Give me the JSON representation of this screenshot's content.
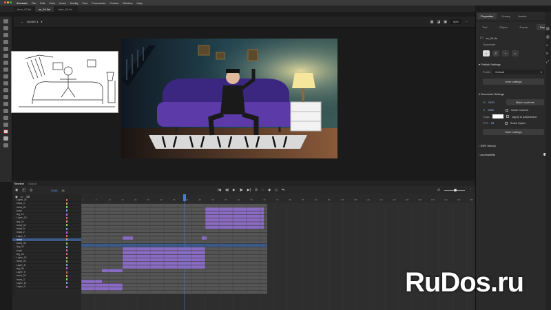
{
  "menu": {
    "app": "Animate",
    "items": [
      "File",
      "Edit",
      "View",
      "Insert",
      "Modify",
      "Text",
      "Commands",
      "Control",
      "Window",
      "Help"
    ]
  },
  "tabs": [
    "farm_03.fla",
    "ss_04.fla*",
    "farm_05.fla"
  ],
  "active_tab": 1,
  "scene": {
    "label": "Scene 1",
    "zoom": "50%"
  },
  "panel": {
    "tabs": [
      "Properties",
      "Library",
      "Assets"
    ],
    "subtabs": [
      "Tool",
      "Object",
      "Frame",
      "Doc"
    ],
    "active_subtab": 3,
    "doc_name": "ss_04.fla",
    "doc_type": "Document",
    "publish_settings": "Publish Settings",
    "profile_label": "Profile",
    "profile_value": "Default",
    "more_settings": "More settings",
    "doc_settings": "Document Settings",
    "width_label": "W",
    "width_value": "1920",
    "height_label": "H",
    "height_value": "1080",
    "match_contents": "Match contents",
    "scale_content": "Scale Content",
    "stage_label": "Stage",
    "apply_pasteboard": "Apply to pasteboard",
    "fps_label": "FPS",
    "fps_value": "23",
    "scale_spans": "Scale Spans",
    "more_settings_2": "More settings",
    "swf_history": "SWF History",
    "accessibility": "Accessibility"
  },
  "timeline": {
    "tabs": [
      "Timeline",
      "Output"
    ],
    "fps_display": "23.98",
    "frame_display": "41"
  },
  "layers": [
    "Layer_24",
    "head_4",
    "hand_01",
    "body",
    "leg_01",
    "Layer_13",
    "leg_02",
    "hand_04",
    "head_9",
    "head_2",
    "Layer_7",
    "head",
    "hand_05",
    "leg_03",
    "body",
    "leg_04",
    "Layer_12",
    "hand_03",
    "Layer_8",
    "leg_05",
    "Layer_9",
    "hand_02",
    "head_3",
    "Layer_11",
    "Layer_2"
  ],
  "selected_layer": 11,
  "ruler_ticks": [
    "1",
    "5",
    "10",
    "15",
    "20",
    "25",
    "30",
    "35",
    "40",
    "45",
    "50",
    "55",
    "60",
    "65",
    "70",
    "75",
    "80",
    "85",
    "90",
    "95",
    "100",
    "105",
    "110",
    "115",
    "120",
    "125",
    "130",
    "135",
    "140",
    "145",
    "150"
  ],
  "watermark": "RuDos.ru",
  "colors": {
    "accent": "#4c7bd6",
    "keyframe_purple": "#8a6bc2",
    "sofa": "#5c3aa8"
  }
}
